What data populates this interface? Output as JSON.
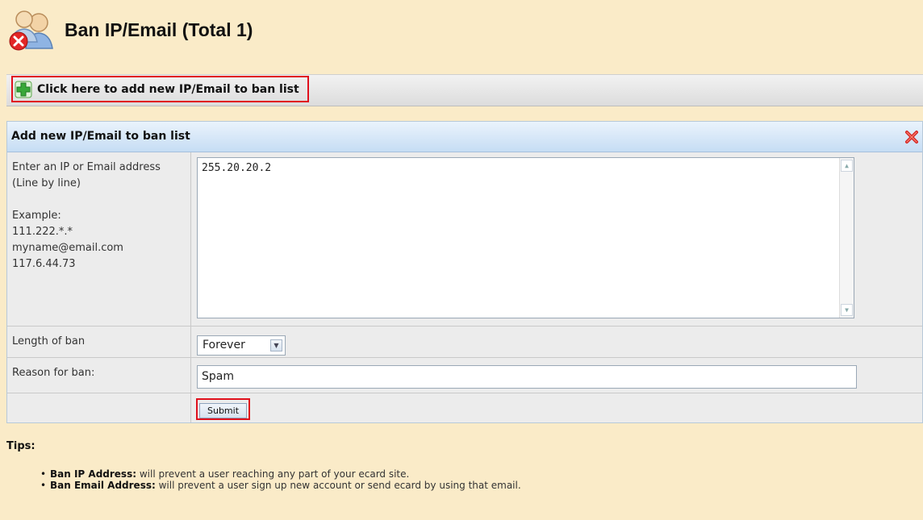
{
  "header": {
    "title": "Ban IP/Email (Total 1)",
    "icon": "users-ban-icon"
  },
  "add_bar": {
    "link_label": "Click here to add new IP/Email to ban list",
    "icon": "green-plus-icon"
  },
  "panel": {
    "title": "Add new IP/Email to ban list",
    "close_icon": "red-x-close-icon",
    "address_row": {
      "label_line1": "Enter an IP or Email address",
      "label_line2": "(Line by line)",
      "example_label": "Example:",
      "examples": [
        "111.222.*.*",
        "myname@email.com",
        "117.6.44.73"
      ],
      "textarea_value": "255.20.20.2"
    },
    "length_row": {
      "label": "Length of ban",
      "selected": "Forever"
    },
    "reason_row": {
      "label": "Reason for ban:",
      "value": "Spam"
    },
    "submit_label": "Submit"
  },
  "tips": {
    "title": "Tips:",
    "items": [
      {
        "term": "Ban IP Address:",
        "text": " will prevent a user reaching any part of your ecard site."
      },
      {
        "term": "Ban Email Address:",
        "text": " will prevent a user sign up new account or send ecard by using that email."
      }
    ]
  },
  "colors": {
    "background": "#faebc8",
    "highlight_border": "#e0101c",
    "panel_header": "#c6ddf4"
  }
}
